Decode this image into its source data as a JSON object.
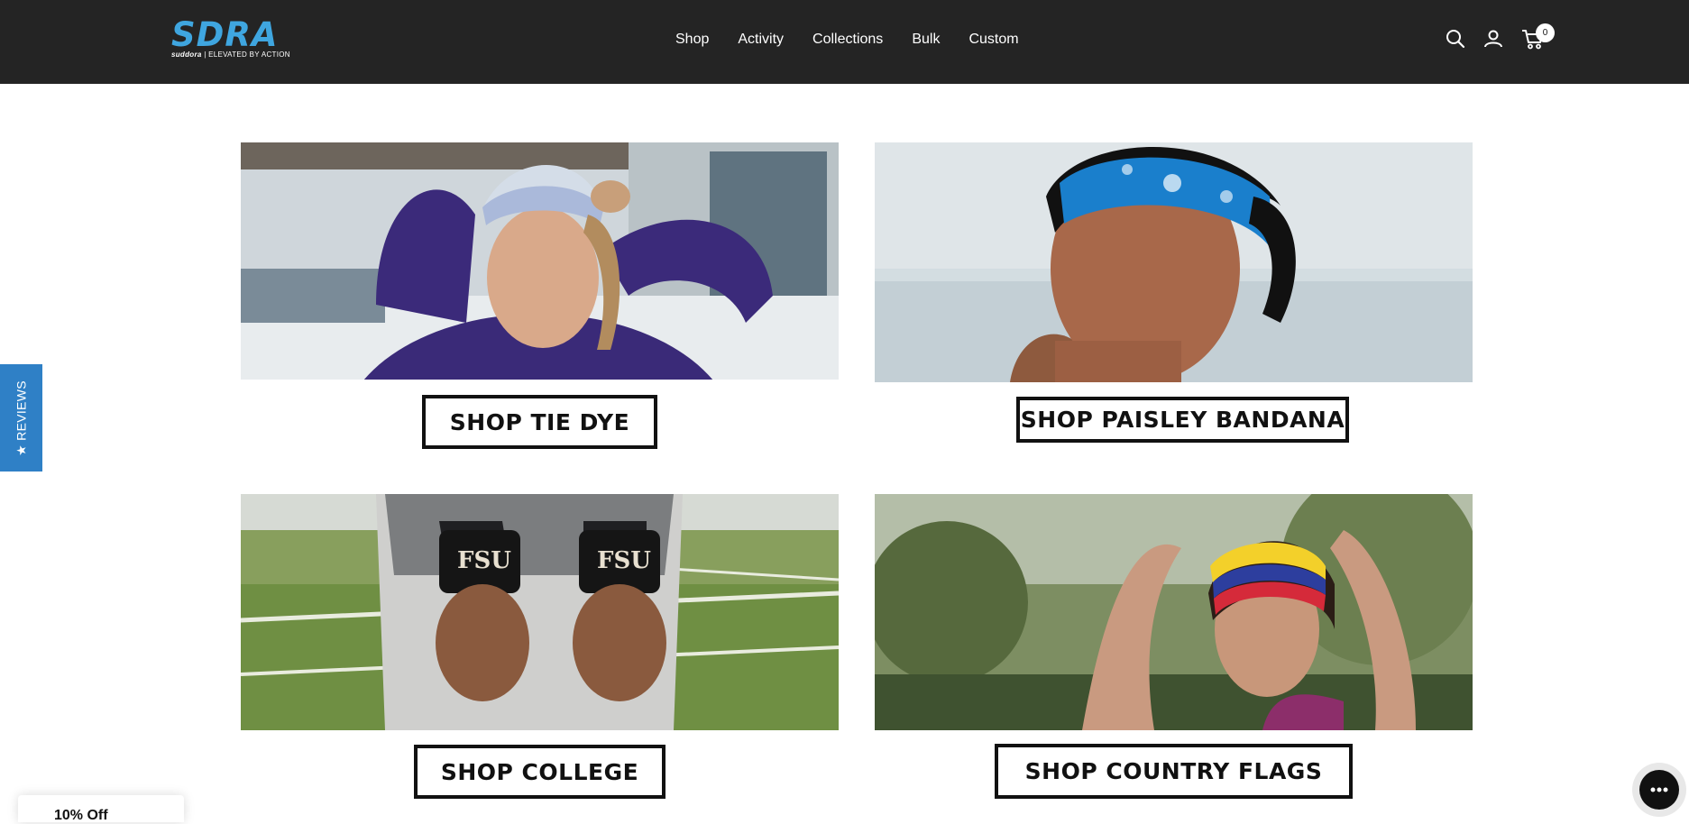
{
  "header": {
    "logo_text": "SDRA",
    "logo_brand": "suddora",
    "logo_tagline": "| ELEVATED BY ACTION",
    "nav": [
      {
        "label": "Shop"
      },
      {
        "label": "Activity"
      },
      {
        "label": "Collections"
      },
      {
        "label": "Bulk"
      },
      {
        "label": "Custom"
      }
    ],
    "icons": [
      "search-icon",
      "account-icon",
      "cart-icon"
    ],
    "cart_count": "0"
  },
  "tiles": [
    {
      "cta": "SHOP TIE DYE"
    },
    {
      "cta": "SHOP PAISLEY BANDANA"
    },
    {
      "cta": "SHOP COLLEGE"
    },
    {
      "cta": "SHOP COUNTRY FLAGS"
    }
  ],
  "reviews_tab": {
    "label": "★ REVIEWS"
  },
  "discount_popup": {
    "label": "10% Off"
  },
  "colors": {
    "header_bg": "#242424",
    "brand_blue": "#3fa6e0",
    "reviews_blue": "#2f80c6"
  }
}
